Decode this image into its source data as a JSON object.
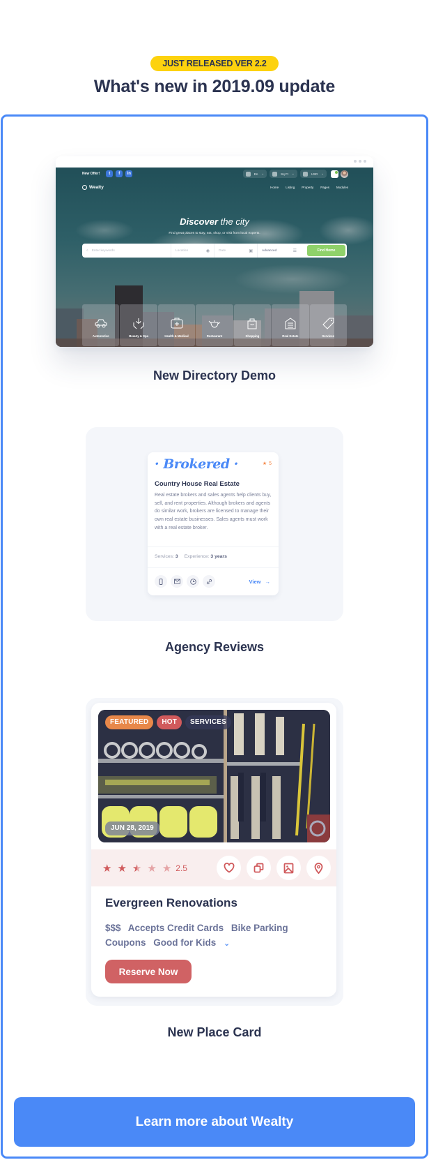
{
  "header": {
    "badge": "JUST RELEASED VER 2.2",
    "title": "What's new in 2019.09 update"
  },
  "directory_demo": {
    "label": "New Directory Demo",
    "topbar": {
      "offer": "New Offer!",
      "social": [
        "twitter-icon",
        "facebook-icon",
        "linkedin-icon"
      ],
      "social_glyphs": [
        "t",
        "f",
        "in"
      ],
      "language": "En",
      "unit": "Sq Ft",
      "currency": "USD"
    },
    "logo": "Wealty",
    "nav": [
      "Home",
      "Listing",
      "Property",
      "Pages",
      "Modules"
    ],
    "hero_title_bold": "Discover",
    "hero_title_rest": "the city",
    "hero_subtitle": "Find great places to stay, eat, shop, or visit from local experts.",
    "search": {
      "keywords_placeholder": "Enter keywords",
      "location_placeholder": "Location",
      "date_placeholder": "Date",
      "advanced": "Advanced",
      "button": "Find Home"
    },
    "categories": [
      "Automotive",
      "Beauty & Spa",
      "Health & Medical",
      "Restaurant",
      "Shopping",
      "Real Estate",
      "Services"
    ]
  },
  "agency_reviews": {
    "label": "Agency Reviews",
    "brand": "· Brokered ·",
    "rating": "5",
    "title": "Country House Real Estate",
    "description": "Real estate brokers and sales agents help clients buy, sell, and rent properties. Although brokers and agents do similar work, brokers are licensed to manage their own real estate businesses. Sales agents must work with a real estate broker.",
    "services_label": "Services:",
    "services_value": "3",
    "experience_label": "Experience:",
    "experience_value": "3 years",
    "actions": [
      "phone-icon",
      "mail-icon",
      "clock-icon",
      "link-icon"
    ],
    "view": "View"
  },
  "place_card": {
    "label": "New Place Card",
    "tags": [
      {
        "text": "FEATURED",
        "color": "#e8884a"
      },
      {
        "text": "HOT",
        "color": "#d05a5c"
      },
      {
        "text": "SERVICES",
        "color": "#363a5a"
      }
    ],
    "date": "JUN 28, 2019",
    "rating": 2.5,
    "rating_max": 5,
    "rating_text": "2.5",
    "actions": [
      "heart-icon",
      "copy-icon",
      "image-icon",
      "map-pin-icon"
    ],
    "title": "Evergreen Renovations",
    "features": [
      "$$$",
      "Accepts Credit Cards",
      "Bike Parking",
      "Coupons",
      "Good for Kids"
    ],
    "reserve": "Reserve Now"
  },
  "cta": {
    "label": "Learn more about Wealty"
  },
  "colors": {
    "accent": "#4a89f7",
    "badge": "#fdd20e",
    "danger": "#d05a5c",
    "find_button": "#8fd16a"
  }
}
